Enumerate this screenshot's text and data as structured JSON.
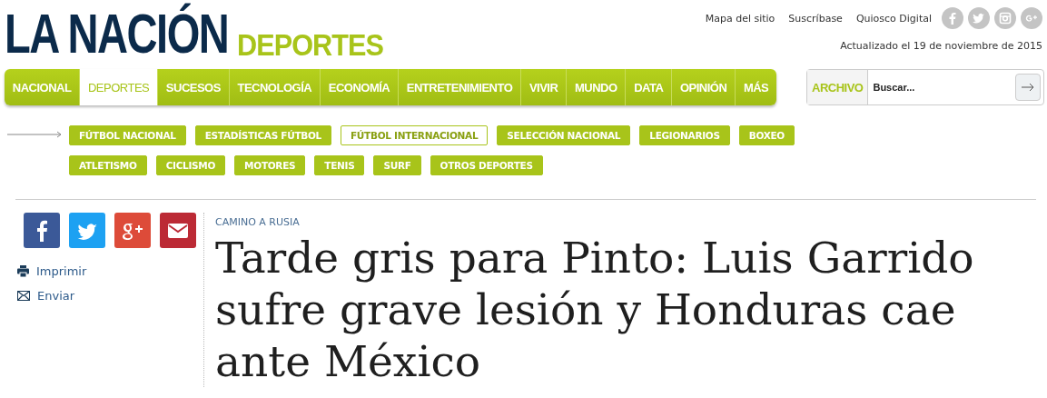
{
  "logo": {
    "name": "LA NACIÓN",
    "section": "DEPORTES"
  },
  "top_links": [
    "Mapa del sitio",
    "Suscríbase",
    "Quiosco Digital"
  ],
  "updated": "Actualizado el 19 de noviembre de 2015",
  "nav": [
    {
      "label": "NACIONAL",
      "selected": false
    },
    {
      "label": "DEPORTES",
      "selected": true
    },
    {
      "label": "SUCESOS",
      "selected": false
    },
    {
      "label": "TECNOLOGÍA",
      "selected": false
    },
    {
      "label": "ECONOMÍA",
      "selected": false
    },
    {
      "label": "ENTRETENIMIENTO",
      "selected": false
    },
    {
      "label": "VIVIR",
      "selected": false
    },
    {
      "label": "MUNDO",
      "selected": false
    },
    {
      "label": "DATA",
      "selected": false
    },
    {
      "label": "OPINIÓN",
      "selected": false
    },
    {
      "label": "MÁS",
      "selected": false
    }
  ],
  "archive": {
    "label": "ARCHIVO",
    "placeholder": "Buscar..."
  },
  "subnav": [
    [
      {
        "label": "FÚTBOL NACIONAL",
        "selected": false
      },
      {
        "label": "ESTADÍSTICAS FÚTBOL",
        "selected": false
      },
      {
        "label": "FÚTBOL INTERNACIONAL",
        "selected": true
      },
      {
        "label": "SELECCIÓN NACIONAL",
        "selected": false
      },
      {
        "label": "LEGIONARIOS",
        "selected": false
      },
      {
        "label": "BOXEO",
        "selected": false
      }
    ],
    [
      {
        "label": "ATLETISMO",
        "selected": false
      },
      {
        "label": "CICLISMO",
        "selected": false
      },
      {
        "label": "MOTORES",
        "selected": false
      },
      {
        "label": "TENIS",
        "selected": false
      },
      {
        "label": "SURF",
        "selected": false
      },
      {
        "label": "OTROS DEPORTES",
        "selected": false
      }
    ]
  ],
  "actions": [
    "Imprimir",
    "Enviar"
  ],
  "article": {
    "kicker": "CAMINO A RUSIA",
    "headline": "Tarde gris para Pinto: Luis Garrido sufre grave lesión y Honduras cae ante México"
  }
}
